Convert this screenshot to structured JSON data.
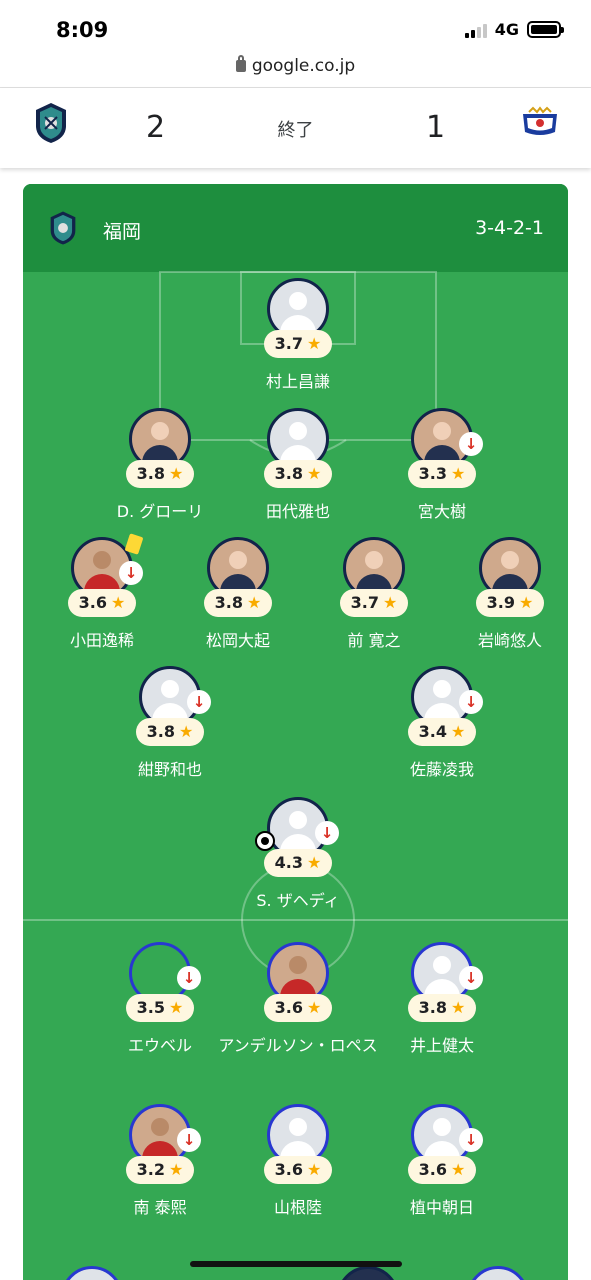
{
  "status_bar": {
    "time": "8:09",
    "network": "4G"
  },
  "browser": {
    "url": "google.co.jp"
  },
  "match": {
    "home_score": "2",
    "away_score": "1",
    "status": "終了",
    "home_crest_icon": "avispa-fukuoka-crest-icon",
    "away_crest_icon": "yokohama-fmarinos-crest-icon"
  },
  "team": {
    "name": "福岡",
    "formation": "3-4-2-1"
  },
  "colors": {
    "pitch": "#34a853",
    "team_bar": "#1e8e3e",
    "rating_bg": "#fef7e0",
    "star": "#f9ab00",
    "sub_arrow": "#d93025",
    "home_ring": "#12244a",
    "away_ring": "#2838d0"
  },
  "home_players": [
    {
      "name": "村上昌謙",
      "rating": "3.7",
      "photo": false,
      "sub": false
    },
    {
      "name": "D. グローリ",
      "rating": "3.8",
      "photo": true,
      "sub": false
    },
    {
      "name": "田代雅也",
      "rating": "3.8",
      "photo": false,
      "sub": false
    },
    {
      "name": "宮大樹",
      "rating": "3.3",
      "photo": true,
      "sub": true
    },
    {
      "name": "小田逸稀",
      "rating": "3.6",
      "photo": true,
      "sub": true,
      "yellow_card": true
    },
    {
      "name": "松岡大起",
      "rating": "3.8",
      "photo": true,
      "sub": false
    },
    {
      "name": "前 寛之",
      "rating": "3.7",
      "photo": true,
      "sub": false
    },
    {
      "name": "岩崎悠人",
      "rating": "3.9",
      "photo": true,
      "sub": false
    },
    {
      "name": "紺野和也",
      "rating": "3.8",
      "photo": false,
      "sub": true
    },
    {
      "name": "佐藤凌我",
      "rating": "3.4",
      "photo": false,
      "sub": true
    },
    {
      "name": "S. ザヘディ",
      "rating": "4.3",
      "photo": false,
      "sub": true,
      "goal": true
    }
  ],
  "away_players": [
    {
      "name": "エウベル",
      "rating": "3.5",
      "photo": false,
      "sub": true
    },
    {
      "name": "アンデルソン・ロペス",
      "rating": "3.6",
      "photo": true,
      "sub": false
    },
    {
      "name": "井上健太",
      "rating": "3.8",
      "photo": false,
      "sub": true
    },
    {
      "name": "南 泰熙",
      "rating": "3.2",
      "photo": true,
      "sub": true
    },
    {
      "name": "山根陸",
      "rating": "3.6",
      "photo": false,
      "sub": false
    },
    {
      "name": "植中朝日",
      "rating": "3.6",
      "photo": false,
      "sub": true
    }
  ]
}
